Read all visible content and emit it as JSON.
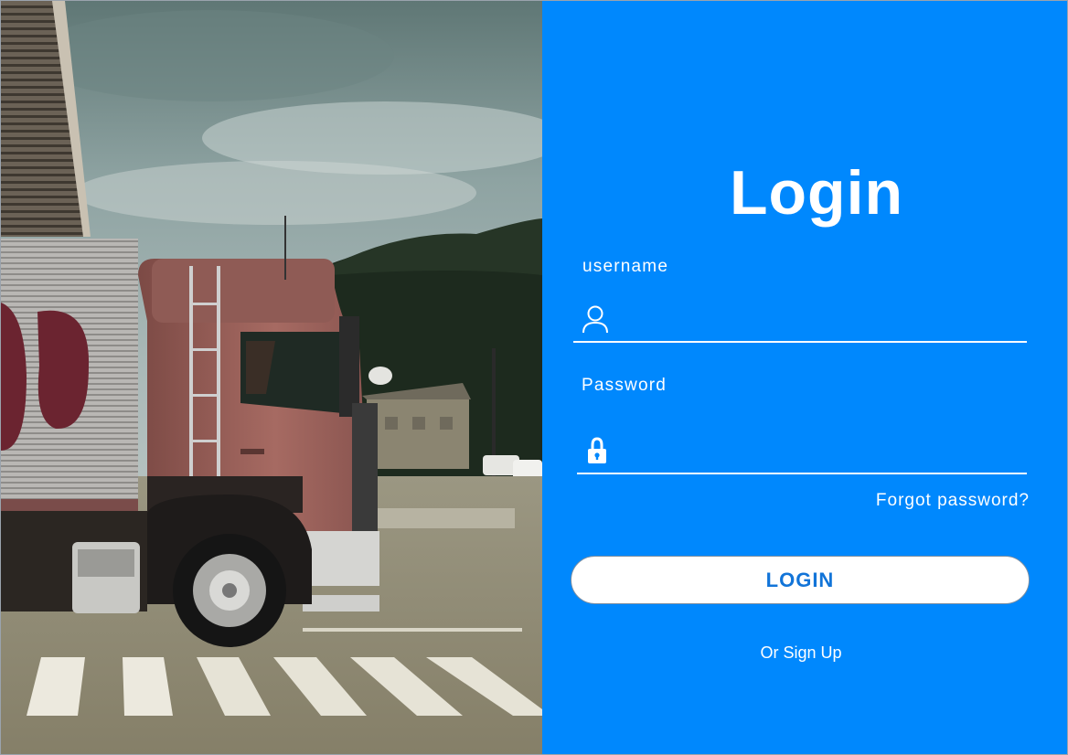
{
  "hero": {
    "image": "truck-photo"
  },
  "form": {
    "title": "Login",
    "username_label": "username",
    "username_value": "",
    "username_icon": "user-icon",
    "password_label": "Password",
    "password_value": "",
    "password_icon": "lock-icon",
    "forgot_password": "Forgot password?",
    "login_button": "LOGIN",
    "signup_link": "Or Sign Up"
  },
  "colors": {
    "panel_background": "#0088fd",
    "button_background": "#ffffff",
    "button_text": "#1274d8",
    "text": "#ffffff"
  }
}
